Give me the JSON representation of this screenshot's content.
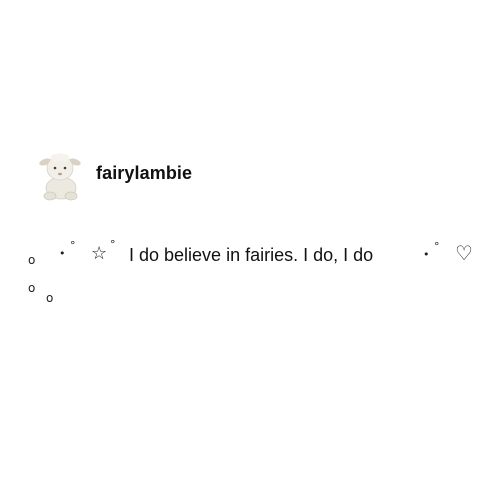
{
  "post": {
    "username": "fairylambie",
    "avatar_icon": "lamb-plush-avatar",
    "decor": {
      "ring": "o",
      "dot": "•",
      "degree": "°",
      "star": "☆",
      "heart": "♡"
    },
    "body_text": "I do believe in fairies. I do, I do"
  }
}
